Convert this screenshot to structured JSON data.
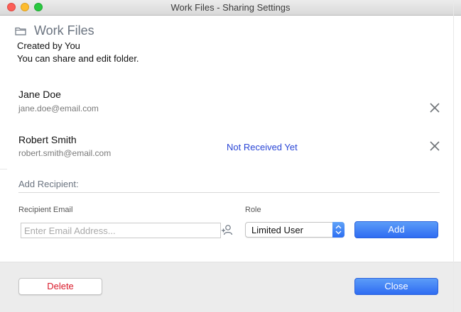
{
  "window": {
    "title": "Work Files - Sharing Settings"
  },
  "folder": {
    "icon": "folder-icon",
    "name": "Work Files",
    "created_by": "Created by You",
    "permission_text": "You can share and edit folder."
  },
  "recipients": [
    {
      "name": "Jane Doe",
      "email": "jane.doe@email.com",
      "status": "",
      "remove_icon": "close-icon"
    },
    {
      "name": "Robert Smith",
      "email": "robert.smith@email.com",
      "status": "Not Received Yet",
      "remove_icon": "close-icon"
    }
  ],
  "add_recipient": {
    "title": "Add Recipient:",
    "email_label": "Recipient Email",
    "email_value": "",
    "email_placeholder": "Enter Email Address...",
    "add_person_icon": "add-person-icon",
    "role_label": "Role",
    "role_selected": "Limited User",
    "add_button": "Add"
  },
  "footer": {
    "delete_button": "Delete",
    "close_button": "Close"
  },
  "colors": {
    "accent": "#3272f2",
    "status_text": "#2a46d6",
    "danger_text": "#d9192a"
  }
}
